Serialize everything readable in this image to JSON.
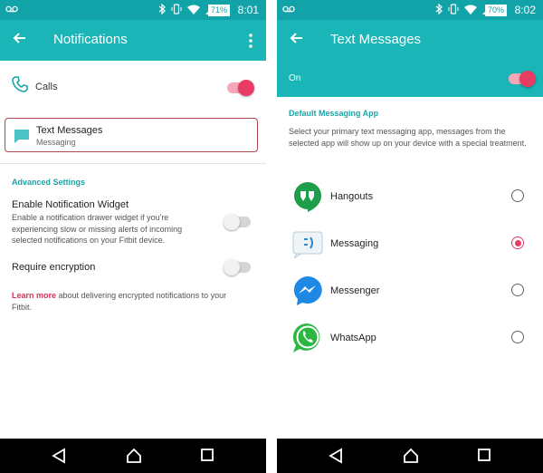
{
  "left_screen": {
    "status_bar": {
      "battery": "71%",
      "time": "8:01"
    },
    "app_bar": {
      "title": "Notifications",
      "back_icon": "arrow-back-icon",
      "menu_icon": "more-vert-icon"
    },
    "calls": {
      "label": "Calls",
      "icon": "phone-icon",
      "enabled": true
    },
    "text_messages": {
      "label": "Text Messages",
      "sublabel": "Messaging",
      "icon": "message-icon"
    },
    "advanced_settings": {
      "heading": "Advanced Settings",
      "widget": {
        "title": "Enable Notification Widget",
        "description": "Enable a notification drawer widget if you're experiencing slow or missing alerts of incoming selected notifications on your Fitbit device.",
        "enabled": false
      },
      "encryption": {
        "title": "Require encryption",
        "enabled": false
      },
      "learn_more": {
        "link": "Learn more",
        "text": " about delivering encrypted notifications to your Fitbit."
      }
    }
  },
  "right_screen": {
    "status_bar": {
      "battery": "70%",
      "time": "8:02"
    },
    "app_bar": {
      "title": "Text Messages",
      "back_icon": "arrow-back-icon"
    },
    "on_row": {
      "label": "On",
      "enabled": true
    },
    "default_app": {
      "heading": "Default Messaging App",
      "description": "Select your primary text messaging app, messages from the selected app will show up on your device with a special treatment.",
      "apps": [
        {
          "label": "Hangouts",
          "icon": "hangouts-icon",
          "selected": false
        },
        {
          "label": "Messaging",
          "icon": "messaging-icon",
          "selected": true
        },
        {
          "label": "Messenger",
          "icon": "messenger-icon",
          "selected": false
        },
        {
          "label": "WhatsApp",
          "icon": "whatsapp-icon",
          "selected": false
        }
      ]
    }
  },
  "colors": {
    "teal": "#19b5b7",
    "status_teal": "#12a3a9",
    "accent_pink": "#e83c65",
    "section_teal": "#1aa5a8"
  }
}
